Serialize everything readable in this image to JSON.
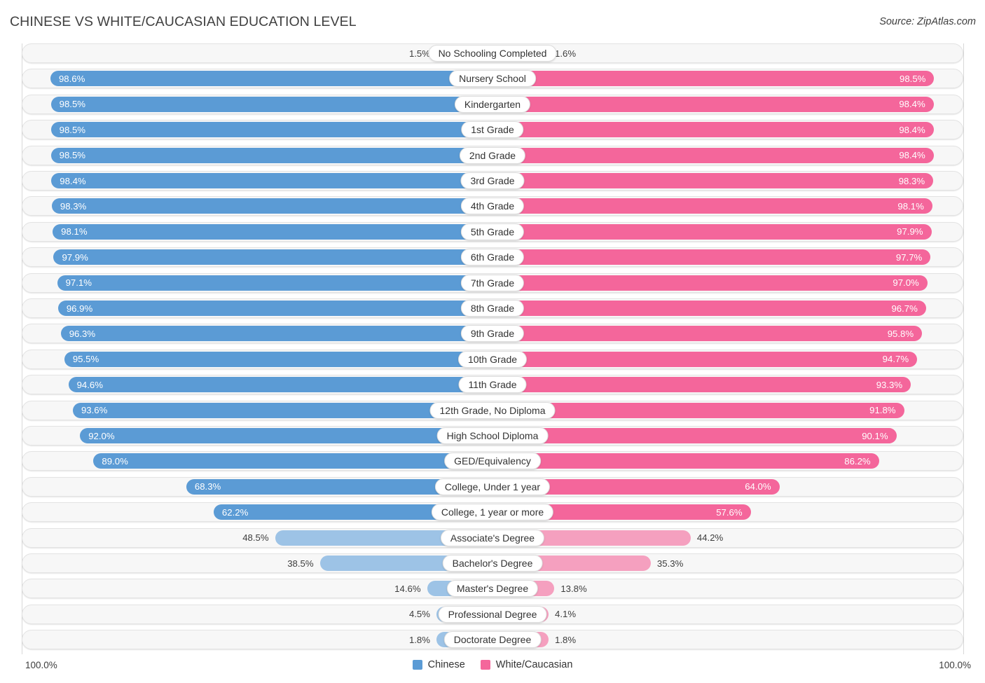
{
  "header": {
    "title": "CHINESE VS WHITE/CAUCASIAN EDUCATION LEVEL",
    "source": "Source: ZipAtlas.com"
  },
  "legend": {
    "items": [
      {
        "label": "Chinese",
        "color": "#5B9BD5"
      },
      {
        "label": "White/Caucasian",
        "color": "#F4669B"
      }
    ]
  },
  "axis": {
    "left_max": "100.0%",
    "right_max": "100.0%"
  },
  "colors": {
    "blue_strong": "#5B9BD5",
    "blue_light": "#9DC3E6",
    "pink_strong": "#F4669B",
    "pink_light": "#F5A0BF",
    "track": "#F7F7F7",
    "track_border": "#E3E3E3"
  },
  "chart_data": {
    "type": "bar",
    "title": "CHINESE VS WHITE/CAUCASIAN EDUCATION LEVEL",
    "subtitle": "Source: ZipAtlas.com",
    "orientation": "horizontal-diverging",
    "xlabel": "",
    "ylabel": "",
    "xlim": [
      0,
      100
    ],
    "grid": false,
    "legend_position": "bottom-center",
    "units": "percent",
    "categories": [
      "No Schooling Completed",
      "Nursery School",
      "Kindergarten",
      "1st Grade",
      "2nd Grade",
      "3rd Grade",
      "4th Grade",
      "5th Grade",
      "6th Grade",
      "7th Grade",
      "8th Grade",
      "9th Grade",
      "10th Grade",
      "11th Grade",
      "12th Grade, No Diploma",
      "High School Diploma",
      "GED/Equivalency",
      "College, Under 1 year",
      "College, 1 year or more",
      "Associate's Degree",
      "Bachelor's Degree",
      "Master's Degree",
      "Professional Degree",
      "Doctorate Degree"
    ],
    "series": [
      {
        "name": "Chinese",
        "color": "#5B9BD5",
        "values": [
          1.5,
          98.6,
          98.5,
          98.5,
          98.5,
          98.4,
          98.3,
          98.1,
          97.9,
          97.1,
          96.9,
          96.3,
          95.5,
          94.6,
          93.6,
          92.0,
          89.0,
          68.3,
          62.2,
          48.5,
          38.5,
          14.6,
          4.5,
          1.8
        ],
        "labels": [
          "1.5%",
          "98.6%",
          "98.5%",
          "98.5%",
          "98.5%",
          "98.4%",
          "98.3%",
          "98.1%",
          "97.9%",
          "97.1%",
          "96.9%",
          "96.3%",
          "95.5%",
          "94.6%",
          "93.6%",
          "92.0%",
          "89.0%",
          "68.3%",
          "62.2%",
          "48.5%",
          "38.5%",
          "14.6%",
          "4.5%",
          "1.8%"
        ]
      },
      {
        "name": "White/Caucasian",
        "color": "#F4669B",
        "values": [
          1.6,
          98.5,
          98.4,
          98.4,
          98.4,
          98.3,
          98.1,
          97.9,
          97.7,
          97.0,
          96.7,
          95.8,
          94.7,
          93.3,
          91.8,
          90.1,
          86.2,
          64.0,
          57.6,
          44.2,
          35.3,
          13.8,
          4.1,
          1.8
        ],
        "labels": [
          "1.6%",
          "98.5%",
          "98.4%",
          "98.4%",
          "98.4%",
          "98.3%",
          "98.1%",
          "97.9%",
          "97.7%",
          "97.0%",
          "96.7%",
          "95.8%",
          "94.7%",
          "93.3%",
          "91.8%",
          "90.1%",
          "86.2%",
          "64.0%",
          "57.6%",
          "44.2%",
          "35.3%",
          "13.8%",
          "4.1%",
          "1.8%"
        ]
      }
    ]
  }
}
